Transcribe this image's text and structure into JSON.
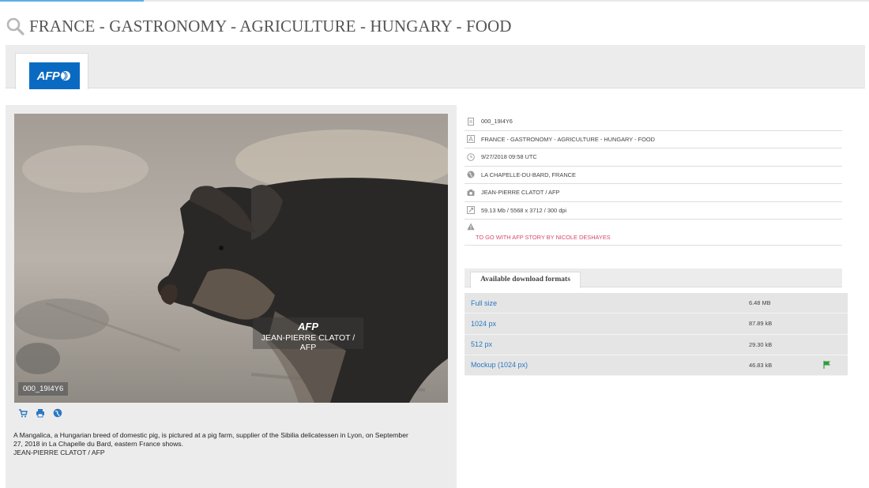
{
  "page": {
    "title": "FRANCE - GASTRONOMY - AGRICULTURE - HUNGARY - FOOD"
  },
  "provider_tab": {
    "logo_text": "AFP"
  },
  "photo": {
    "watermark_logo": "AFP",
    "watermark_credit": "JEAN-PIERRE CLATOT / AFP",
    "id_badge": "000_19I4Y6",
    "caption_lines": [
      "A Mangalica, a Hungarian breed of domestic pig, is pictured at a pig farm, supplier of the Sibilia delicatessen in Lyon, on September",
      "27, 2018 in La Chapelle du Bard, eastern France shows.",
      "JEAN-PIERRE CLATOT / AFP"
    ],
    "actions": [
      "cart-icon",
      "print-icon",
      "globe-icon"
    ]
  },
  "metadata": {
    "id": "000_19I4Y6",
    "headline": "FRANCE - GASTRONOMY - AGRICULTURE - HUNGARY - FOOD",
    "date": "9/27/2018 09:58 UTC",
    "location": "LA CHAPELLE-DU-BARD, FRANCE",
    "credit": "JEAN-PIERRE CLATOT / AFP",
    "file_info": "59.13 Mb / 5568 x 3712 / 300 dpi",
    "warning": "TO GO WITH AFP STORY BY NICOLE DESHAYES"
  },
  "downloads": {
    "tab_label": "Available download formats",
    "rows": [
      {
        "name": "Full size",
        "size": "6.48 MB",
        "flag": false
      },
      {
        "name": "1024 px",
        "size": "87.89 kB",
        "flag": false
      },
      {
        "name": "512 px",
        "size": "29.30 kB",
        "flag": false
      },
      {
        "name": "Mockup (1024 px)",
        "size": "46.83 kB",
        "flag": true
      }
    ]
  },
  "colors": {
    "accent_blue": "#2a78c2",
    "afp_blue": "#0a6ac2",
    "warning_red": "#d64a6a",
    "flag_green": "#2e9e3c"
  }
}
